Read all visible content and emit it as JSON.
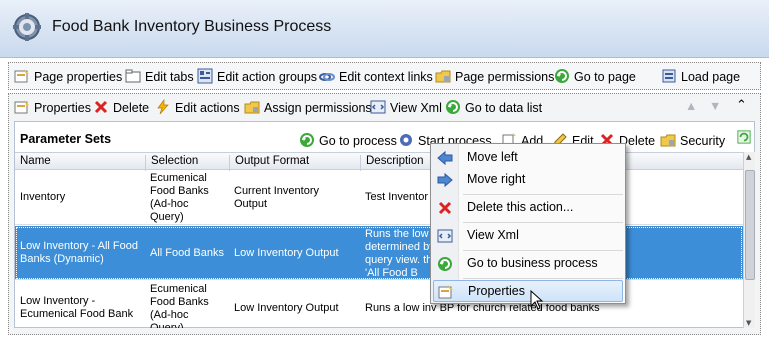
{
  "window": {
    "title": "Food Bank Inventory Business Process"
  },
  "toolbar1": {
    "page_properties": "Page properties",
    "edit_tabs": "Edit tabs",
    "edit_action_groups": "Edit action groups",
    "edit_context_links": "Edit context links",
    "page_permissions": "Page permissions",
    "go_to_page": "Go to page",
    "load_page": "Load page"
  },
  "toolbar2": {
    "properties": "Properties",
    "delete": "Delete",
    "edit_actions": "Edit actions",
    "assign_permissions": "Assign permissions",
    "view_xml": "View Xml",
    "go_to_data_list": "Go to data list"
  },
  "parameter_sets": {
    "title": "Parameter Sets",
    "go_to_process": "Go to process",
    "start_process": "Start process",
    "add": "Add",
    "edit": "Edit",
    "delete": "Delete",
    "security": "Security",
    "columns": [
      "Name",
      "Selection",
      "Output Format",
      "Description"
    ],
    "rows": [
      {
        "name": "Inventory",
        "selection": "Ecumenical Food Banks (Ad-hoc Query)",
        "output": "Current Inventory Output",
        "description": "Test Inventor"
      },
      {
        "name": "Low Inventory  - All Food Banks (Dynamic)",
        "selection": "All Food Banks",
        "output": "Low Inventory Output",
        "description": "Runs the low determined by query view.  the 'All Food B"
      },
      {
        "name": "Low Inventory - Ecumenical Food Bank",
        "selection": "Ecumenical Food Banks (Ad-hoc Query)",
        "output": "Low Inventory Output",
        "description": "Runs a low inv BP for church related food banks"
      }
    ]
  },
  "context_menu": {
    "move_left": "Move left",
    "move_right": "Move right",
    "delete_action": "Delete this action...",
    "view_xml": "View Xml",
    "go_to_bp": "Go to business process",
    "properties": "Properties"
  },
  "colors": {
    "selection": "#3b8ed7",
    "title_bg": "#c9d9ee",
    "menu_hover": "#cfe3f9"
  }
}
